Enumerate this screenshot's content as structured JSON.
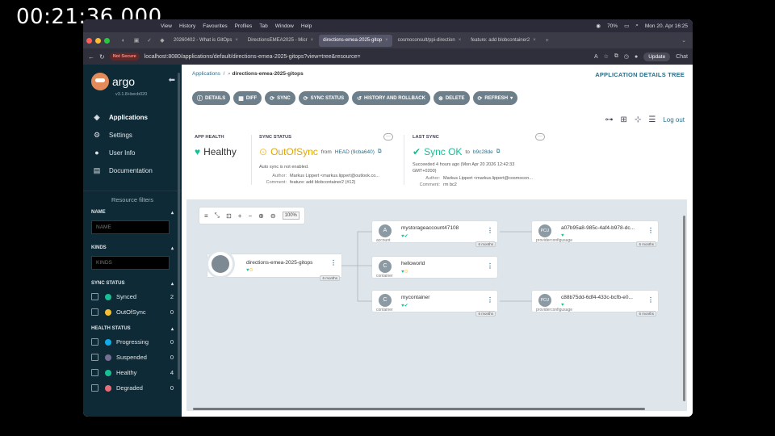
{
  "timestamp": "00:21:36.000",
  "menubar": {
    "items": [
      "View",
      "History",
      "Favourites",
      "Profiles",
      "Tab",
      "Window",
      "Help"
    ],
    "battery": "70%",
    "clock": "Mon 20. Apr 16:25"
  },
  "tabs": [
    {
      "label": "20260402 - What is GitOps",
      "active": false
    },
    {
      "label": "DirectionsEMEA2025 - Micr",
      "active": false
    },
    {
      "label": "directions-emea-2025-gitop",
      "active": true
    },
    {
      "label": "cosmoconsult/ppi-direction",
      "active": false
    },
    {
      "label": "feature: add blobcontainer2",
      "active": false
    }
  ],
  "address": {
    "not_secure": "Not Secure",
    "url": "localhost:8080/applications/default/directions-emea-2025-gitops?view=tree&resource=",
    "update_label": "Update",
    "chat_label": "Chat"
  },
  "sidebar": {
    "title": "argo",
    "version": "v3.1.8+becb020",
    "nav": [
      {
        "label": "Applications",
        "icon": "layers-icon",
        "active": true
      },
      {
        "label": "Settings",
        "icon": "gear-icon",
        "active": false
      },
      {
        "label": "User Info",
        "icon": "user-icon",
        "active": false
      },
      {
        "label": "Documentation",
        "icon": "book-icon",
        "active": false
      }
    ],
    "resource_filters": "Resource filters",
    "name_label": "NAME",
    "name_placeholder": "NAME",
    "kinds_label": "KINDS",
    "kinds_placeholder": "KINDS",
    "sync_status_label": "SYNC STATUS",
    "sync_items": [
      {
        "label": "Synced",
        "count": "2",
        "color": "#18be94"
      },
      {
        "label": "OutOfSync",
        "count": "0",
        "color": "#f4c030"
      }
    ],
    "health_status_label": "HEALTH STATUS",
    "health_items": [
      {
        "label": "Progressing",
        "count": "0",
        "color": "#0dadea"
      },
      {
        "label": "Suspended",
        "count": "0",
        "color": "#766f94"
      },
      {
        "label": "Healthy",
        "count": "4",
        "color": "#18be94"
      },
      {
        "label": "Degraded",
        "count": "0",
        "color": "#e96d76"
      }
    ]
  },
  "main": {
    "breadcrumb_root": "Applications",
    "breadcrumb_current": "directions-emea-2025-gitops",
    "page_title": "APPLICATION DETAILS TREE",
    "toolbar": [
      {
        "label": "DETAILS",
        "icon": "info-icon"
      },
      {
        "label": "DIFF",
        "icon": "diff-icon"
      },
      {
        "label": "SYNC",
        "icon": "sync-icon"
      },
      {
        "label": "SYNC STATUS",
        "icon": "sync-status-icon"
      },
      {
        "label": "HISTORY AND ROLLBACK",
        "icon": "history-icon"
      },
      {
        "label": "DELETE",
        "icon": "delete-icon"
      },
      {
        "label": "REFRESH",
        "icon": "refresh-icon"
      }
    ],
    "logout": "Log out"
  },
  "status": {
    "app_health_title": "APP HEALTH",
    "app_health_value": "Healthy",
    "sync_status_title": "SYNC STATUS",
    "sync_status_value": "OutOfSync",
    "sync_from": "from",
    "sync_head": "HEAD (9cba640)",
    "auto_sync": "Auto sync is not enabled.",
    "sync_author_label": "Author:",
    "sync_author": "Markus Lippert <markus.lippert@outlook.co...",
    "sync_comment_label": "Comment:",
    "sync_comment": "feature: add blobcontainer2 (#12)",
    "last_sync_title": "LAST SYNC",
    "last_sync_value": "Sync OK",
    "last_sync_to": "to",
    "last_sync_rev": "b9c28de",
    "last_sync_succeeded": "Succeeded 4 hours ago (Mon Apr 20 2026 12:42:33 GMT+0200)",
    "last_author_label": "Author:",
    "last_author": "Markus Lippert <markus.lippert@cosmocon...",
    "last_comment_label": "Comment:",
    "last_comment": "rm bc2"
  },
  "graph": {
    "zoom": "100%",
    "root": {
      "name": "directions-emea-2025-gitops",
      "age": "6 months"
    },
    "nodes": [
      {
        "name": "mystorageaccount47108",
        "kind": "account",
        "abbr": "A",
        "age": "6 months"
      },
      {
        "name": "helloworld",
        "kind": "container",
        "abbr": "C",
        "age": ""
      },
      {
        "name": "mycontainer",
        "kind": "container",
        "abbr": "C",
        "age": "6 months"
      },
      {
        "name": "a07b95a8-985c-4af4-b978-dc...",
        "kind": "providerconfigusage",
        "abbr": "PCU",
        "age": "6 months"
      },
      {
        "name": "c88b75dd-6df4-433c-bcfb-e0...",
        "kind": "providerconfigusage",
        "abbr": "PCU",
        "age": "6 months"
      }
    ]
  }
}
